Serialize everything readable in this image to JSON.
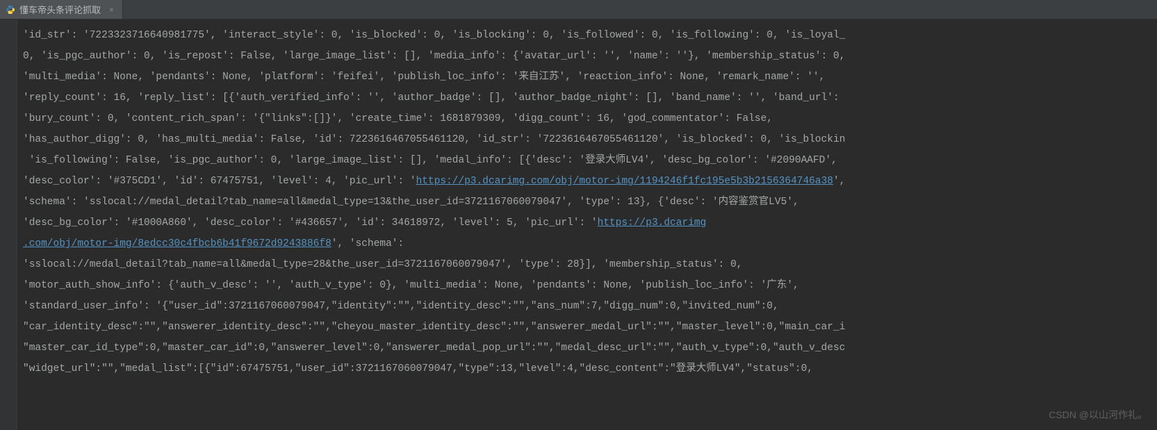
{
  "tab": {
    "title": "懂车帝头条评论抓取",
    "close": "×"
  },
  "code": {
    "lines": [
      {
        "text": "'id_str': '7223323716640981775', 'interact_style': 0, 'is_blocked': 0, 'is_blocking': 0, 'is_followed': 0, 'is_following': 0, 'is_loyal_"
      },
      {
        "text": "0, 'is_pgc_author': 0, 'is_repost': False, 'large_image_list': [], 'media_info': {'avatar_url': '', 'name': ''}, 'membership_status': 0,"
      },
      {
        "text": "'multi_media': None, 'pendants': None, 'platform': 'feifei', 'publish_loc_info': '来自江苏', 'reaction_info': None, 'remark_name': '', "
      },
      {
        "text": "'reply_count': 16, 'reply_list': [{'auth_verified_info': '', 'author_badge': [], 'author_badge_night': [], 'band_name': '', 'band_url': "
      },
      {
        "text": "'bury_count': 0, 'content_rich_span': '{\"links\":[]}', 'create_time': 1681879309, 'digg_count': 16, 'god_commentator': False, "
      },
      {
        "text": "'has_author_digg': 0, 'has_multi_media': False, 'id': 7223616467055461120, 'id_str': '7223616467055461120', 'is_blocked': 0, 'is_blockin"
      },
      {
        "text": " 'is_following': False, 'is_pgc_author': 0, 'large_image_list': [], 'medal_info': [{'desc': '登录大师LV4', 'desc_bg_color': '#2090AAFD', "
      },
      {
        "text": "'desc_color': '#375CD1', 'id': 67475751, 'level': 4, 'pic_url': '",
        "url": "https://p3.dcarimg.com/obj/motor-img/1194246f1fc195e5b3b2156364746a38",
        "suffix": "', "
      },
      {
        "text": "'schema': 'sslocal://medal_detail?tab_name=all&medal_type=13&the_user_id=3721167060079047', 'type': 13}, {'desc': '内容鉴赏官LV5', "
      },
      {
        "text": "'desc_bg_color': '#1000A860', 'desc_color': '#436657', 'id': 34618972, 'level': 5, 'pic_url': '",
        "url": "https://p3.dcarimg"
      },
      {
        "url": ".com/obj/motor-img/8edcc30c4fbcb6b41f9672d9243886f8",
        "suffix": "', 'schema': "
      },
      {
        "text": "'sslocal://medal_detail?tab_name=all&medal_type=28&the_user_id=3721167060079047', 'type': 28}], 'membership_status': 0, "
      },
      {
        "text": "'motor_auth_show_info': {'auth_v_desc': '', 'auth_v_type': 0}, 'multi_media': None, 'pendants': None, 'publish_loc_info': '广东', "
      },
      {
        "text": "'standard_user_info': '{\"user_id\":3721167060079047,\"identity\":\"\",\"identity_desc\":\"\",\"ans_num\":7,\"digg_num\":0,\"invited_num\":0,"
      },
      {
        "text": "\"car_identity_desc\":\"\",\"answerer_identity_desc\":\"\",\"cheyou_master_identity_desc\":\"\",\"answerer_medal_url\":\"\",\"master_level\":0,\"main_car_i"
      },
      {
        "text": "\"master_car_id_type\":0,\"master_car_id\":0,\"answerer_level\":0,\"answerer_medal_pop_url\":\"\",\"medal_desc_url\":\"\",\"auth_v_type\":0,\"auth_v_desc"
      },
      {
        "text": "\"widget_url\":\"\",\"medal_list\":[{\"id\":67475751,\"user_id\":3721167060079047,\"type\":13,\"level\":4,\"desc_content\":\"登录大师LV4\",\"status\":0,"
      }
    ]
  },
  "watermark": "CSDN @以山河作礼。"
}
